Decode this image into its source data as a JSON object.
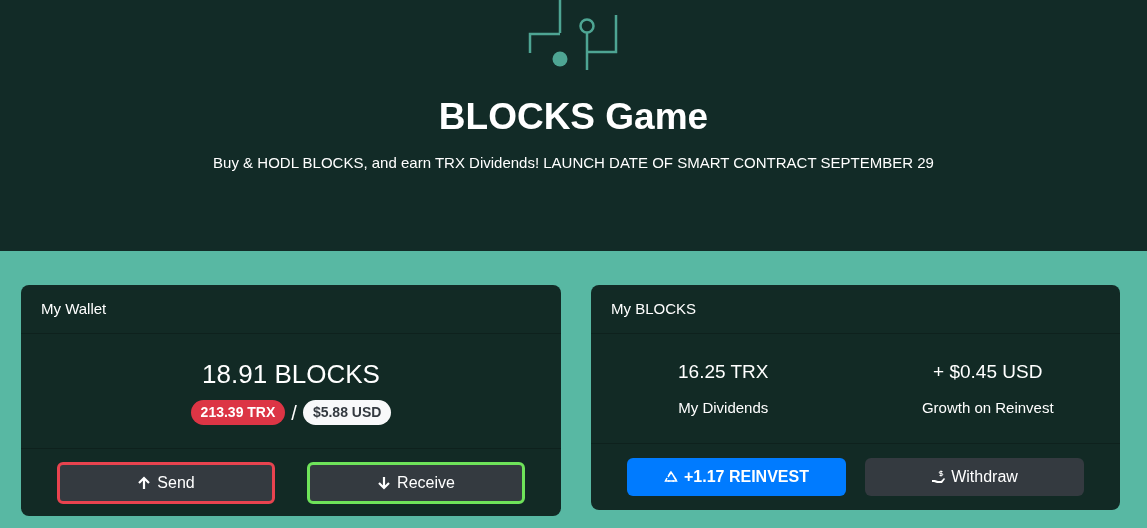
{
  "hero": {
    "title": "BLOCKS Game",
    "subtitle": "Buy & HODL BLOCKS, and earn TRX Dividends! LAUNCH DATE OF SMART CONTRACT SEPTEMBER 29"
  },
  "wallet": {
    "title": "My Wallet",
    "amount": "18.91 BLOCKS",
    "trx_badge": "213.39 TRX",
    "separator": "/",
    "usd_badge": "$5.88 USD",
    "buttons": [
      {
        "kind": "send",
        "label": "Send"
      },
      {
        "kind": "receive",
        "label": "Receive"
      }
    ]
  },
  "blocks": {
    "title": "My BLOCKS",
    "stats": [
      {
        "value": "16.25 TRX",
        "label": "My Dividends"
      },
      {
        "value": "+ $0.45 USD",
        "label": "Growth on Reinvest"
      }
    ],
    "buttons": [
      {
        "kind": "reinvest",
        "label": "+1.17 REINVEST"
      },
      {
        "kind": "withdraw",
        "label": "Withdraw"
      }
    ]
  }
}
